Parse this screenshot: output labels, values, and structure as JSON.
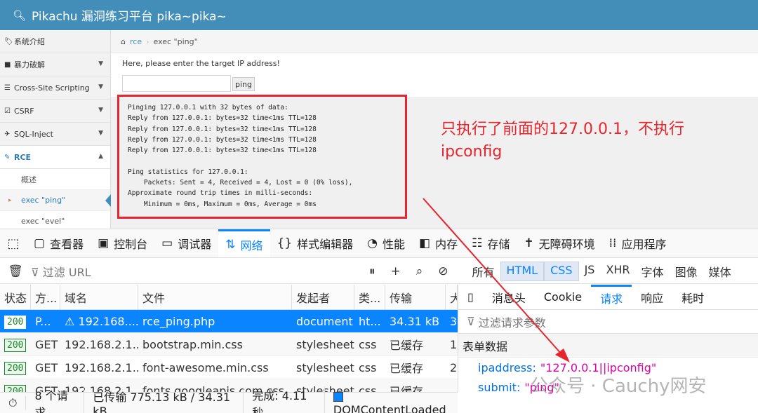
{
  "app": {
    "title": "Pikachu 漏洞练习平台 pika~pika~"
  },
  "sidebar": {
    "items": [
      {
        "icon": "tags-icon",
        "label": "系统介绍"
      },
      {
        "icon": "lock-icon",
        "label": "暴力破解"
      },
      {
        "icon": "list-icon",
        "label": "Cross-Site Scripting"
      },
      {
        "icon": "edit-icon",
        "label": "CSRF"
      },
      {
        "icon": "plane-icon",
        "label": "SQL-Inject"
      },
      {
        "icon": "pencil-icon",
        "label": "RCE"
      }
    ],
    "subitems": [
      {
        "label": "概述"
      },
      {
        "label": "exec \"ping\""
      },
      {
        "label": "exec \"evel\""
      }
    ]
  },
  "breadcrumb": {
    "link": "rce",
    "current": "exec \"ping\""
  },
  "form": {
    "prompt": "Here, please enter the target IP address!",
    "input_value": "",
    "button": "ping"
  },
  "output": {
    "lines": [
      "Pinging 127.0.0.1 with 32 bytes of data:",
      "Reply from 127.0.0.1: bytes=32 time<1ms TTL=128",
      "Reply from 127.0.0.1: bytes=32 time<1ms TTL=128",
      "Reply from 127.0.0.1: bytes=32 time<1ms TTL=128",
      "Reply from 127.0.0.1: bytes=32 time<1ms TTL=128",
      "",
      "Ping statistics for 127.0.0.1:",
      "    Packets: Sent = 4, Received = 4, Lost = 0 (0% loss),",
      "Approximate round trip times in milli-seconds:",
      "    Minimum = 0ms, Maximum = 0ms, Average = 0ms"
    ]
  },
  "annotation": {
    "line1": "只执行了前面的127.0.0.1，不执行",
    "line2": "ipconfig",
    "color": "#e8252e"
  },
  "devtools": {
    "tabs": [
      {
        "icon": "inspector-icon",
        "label": "查看器"
      },
      {
        "icon": "console-icon",
        "label": "控制台"
      },
      {
        "icon": "debugger-icon",
        "label": "调试器"
      },
      {
        "icon": "network-icon",
        "label": "网络"
      },
      {
        "icon": "style-editor-icon",
        "label": "样式编辑器"
      },
      {
        "icon": "performance-icon",
        "label": "性能"
      },
      {
        "icon": "memory-icon",
        "label": "内存"
      },
      {
        "icon": "storage-icon",
        "label": "存储"
      },
      {
        "icon": "accessibility-icon",
        "label": "无障碍环境"
      },
      {
        "icon": "application-icon",
        "label": "应用程序"
      }
    ],
    "filter_placeholder": "过滤 URL",
    "types": [
      "所有",
      "HTML",
      "CSS",
      "JS",
      "XHR",
      "字体",
      "图像",
      "媒体"
    ],
    "columns": [
      "状态",
      "方...",
      "域名",
      "文件",
      "发起者",
      "类...",
      "传输",
      "大"
    ],
    "rows": [
      {
        "status": "200",
        "method": "P...",
        "domain": "192.168....",
        "file": "rce_ping.php",
        "initiator": "document",
        "type": "ht...",
        "transfer": "34.31 kB",
        "size": "3"
      },
      {
        "status": "200",
        "method": "GET",
        "domain": "192.168.2.1...",
        "file": "bootstrap.min.css",
        "initiator": "stylesheet",
        "type": "css",
        "transfer": "已缓存",
        "size": "1"
      },
      {
        "status": "200",
        "method": "GET",
        "domain": "192.168.2.1...",
        "file": "font-awesome.min.css",
        "initiator": "stylesheet",
        "type": "css",
        "transfer": "已缓存",
        "size": "2"
      },
      {
        "status": "200",
        "method": "GET",
        "domain": "192.168.2.1...",
        "file": "fonts.googleapis.com.css",
        "initiator": "stylesheet",
        "type": "css",
        "transfer": "已缓存",
        "size": ""
      }
    ],
    "panel_tabs": [
      "消息头",
      "Cookie",
      "请求",
      "响应",
      "耗时"
    ],
    "panel_filter": "过滤请求参数",
    "form_title": "表单数据",
    "params": [
      {
        "key": "ipaddress:",
        "value": "\"127.0.0.1||ipconfig\""
      },
      {
        "key": "submit:",
        "value": "\"ping\""
      }
    ],
    "status": {
      "requests": "8 个请求",
      "transferred": "已传输 775.13 kB / 34.31 kB",
      "finish": "完成: 4.11 秒",
      "dcl": "DOMContentLoaded"
    }
  },
  "watermark": "公众号 · Cauchy网安"
}
